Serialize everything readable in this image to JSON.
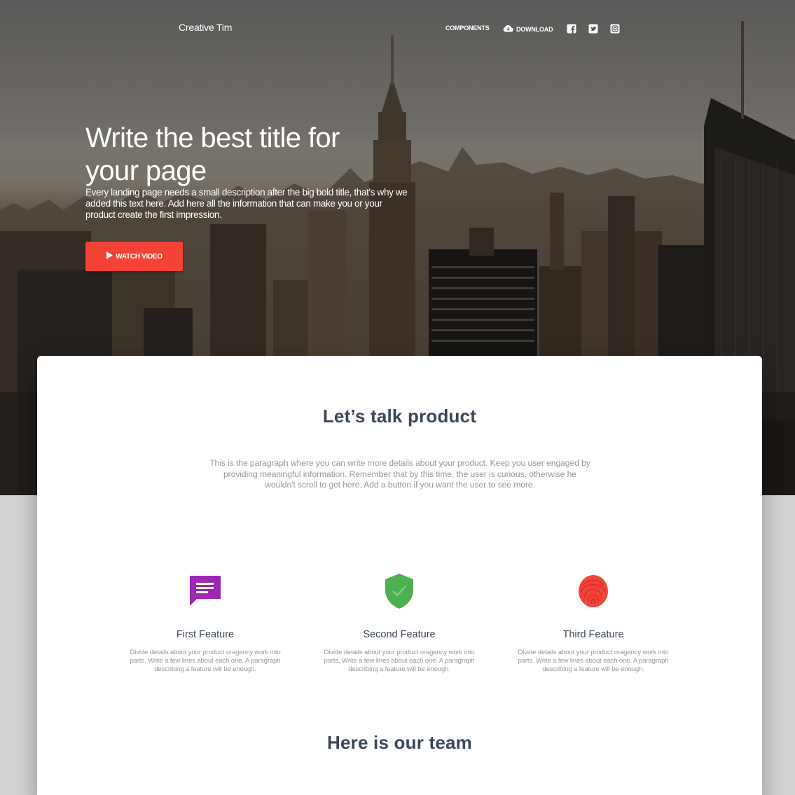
{
  "navbar": {
    "brand": "Creative Tim",
    "links": [
      {
        "label": "COMPONENTS",
        "icon": "none"
      },
      {
        "label": "DOWNLOAD",
        "icon": "cloud-download-icon"
      }
    ],
    "social": [
      "facebook-icon",
      "twitter-icon",
      "instagram-icon"
    ]
  },
  "hero": {
    "title": "Write the best title for your page",
    "description": "Every landing page needs a small description after the big bold title, that's why we added this text here. Add here all the information that can make you or your product create the first impression.",
    "button_label": "WATCH VIDEO"
  },
  "product": {
    "title": "Let’s talk product",
    "description": "This is the paragraph where you can write more details about your product. Keep you user engaged by providing meaningful information. Remember that by this time, the user is curious, otherwise he wouldn't scroll to get here. Add a button if you want the user to see more."
  },
  "features": [
    {
      "title": "First Feature",
      "icon": "chat-icon",
      "color": "#9c27b0",
      "text": "Divide details about your product oragency work into parts. Write a few lines about each one. A paragraph describing a feature will be enough."
    },
    {
      "title": "Second Feature",
      "icon": "verified-shield-icon",
      "color": "#4caf50",
      "text": "Divide details about your product oragency work into parts. Write a few lines about each one. A paragraph describing a feature will be enough."
    },
    {
      "title": "Third Feature",
      "icon": "fingerprint-icon",
      "color": "#f44336",
      "text": "Divide details about your product oragency work into parts. Write a few lines about each one. A paragraph describing a feature will be enough."
    }
  ],
  "team": {
    "title": "Here is our team"
  },
  "colors": {
    "primary_button": "#f44336",
    "heading": "#3c4858",
    "muted_text": "#999999"
  }
}
